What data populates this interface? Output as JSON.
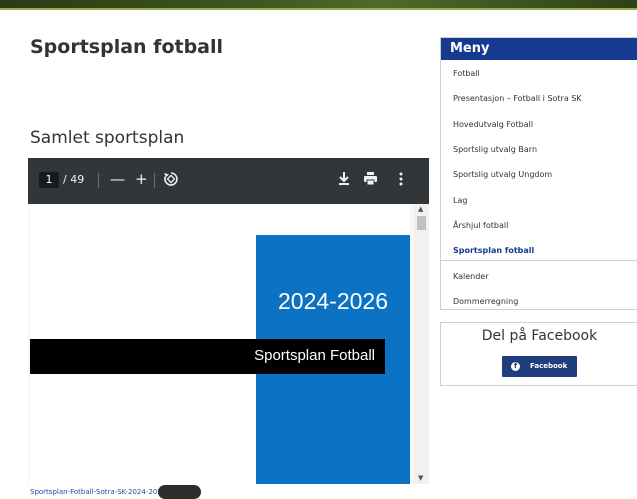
{
  "page": {
    "title": "Sportsplan fotball",
    "section_title": "Samlet sportsplan"
  },
  "pdf_viewer": {
    "current_page": "1",
    "total_pages": "/ 49",
    "zoom_out": "—",
    "zoom_in": "+",
    "rotate_icon": "rotate-icon",
    "download_icon": "download-icon",
    "print_icon": "print-icon",
    "more_icon": "more-vert-icon",
    "document": {
      "year": "2024-2026",
      "title": "Sportsplan Fotball"
    }
  },
  "file": {
    "link_text": "Sportsplan-Fotball-Sotra-SK-2024-2026"
  },
  "menu": {
    "header": "Meny",
    "items": [
      {
        "label": "Fotball",
        "active": false
      },
      {
        "label": "Presentasjon – Fotball i Sotra SK",
        "active": false
      },
      {
        "label": "Hovedutvalg Fotball",
        "active": false
      },
      {
        "label": "Sportslig utvalg Barn",
        "active": false
      },
      {
        "label": "Sportslig utvalg Ungdom",
        "active": false
      },
      {
        "label": "Lag",
        "active": false
      },
      {
        "label": "Årshjul fotball",
        "active": false
      },
      {
        "label": "Sportsplan fotball",
        "active": true
      },
      {
        "label": "Kalender",
        "active": false
      },
      {
        "label": "Dommerregning",
        "active": false
      }
    ]
  },
  "share": {
    "title": "Del på Facebook",
    "button_label": "Facebook"
  },
  "colors": {
    "menu_header": "#163a8f",
    "pdf_toolbar": "#323639",
    "doc_blue": "#0b72c4",
    "facebook_button": "#203d7c"
  }
}
